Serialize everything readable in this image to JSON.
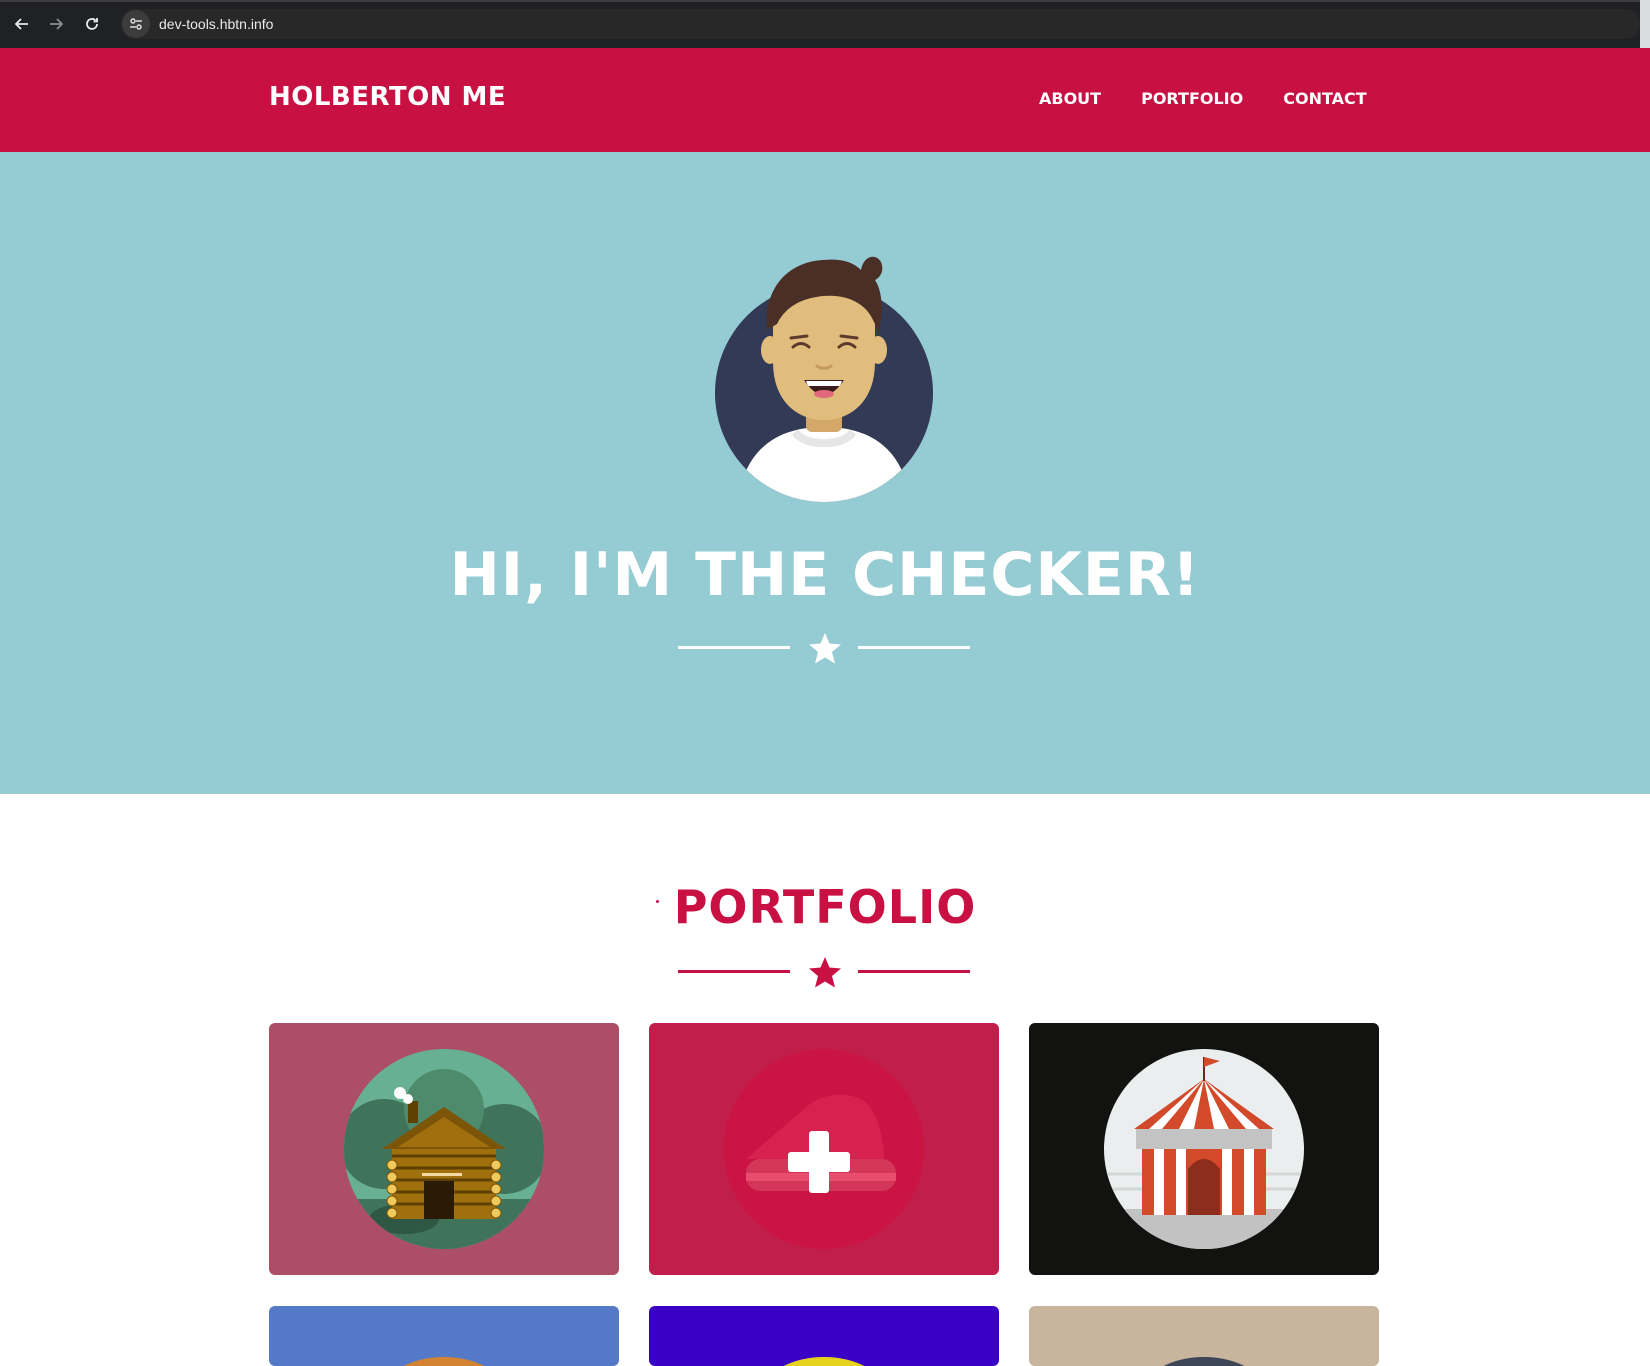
{
  "browser": {
    "url": "dev-tools.hbtn.info",
    "icons": [
      "back-arrow-icon",
      "forward-arrow-icon",
      "reload-icon",
      "site-info-icon"
    ]
  },
  "header": {
    "brand": "HOLBERTON ME",
    "nav": [
      "ABOUT",
      "PORTFOLIO",
      "CONTACT"
    ]
  },
  "hero": {
    "title": "HI, I'M THE CHECKER!"
  },
  "portfolio": {
    "title": "PORTFOLIO",
    "tiles": [
      {
        "icon": "cabin-icon",
        "bg": "#ad4e67"
      },
      {
        "icon": "cake-icon",
        "bg": "#c21e4b"
      },
      {
        "icon": "circus-tent-icon",
        "bg": "#121210"
      },
      {
        "icon": "partial-icon",
        "bg": "#5379c7"
      },
      {
        "icon": "partial-icon",
        "bg": "#3b00c6"
      },
      {
        "icon": "partial-icon",
        "bg": "#c9b49e"
      }
    ]
  },
  "colors": {
    "primary": "#c91043",
    "hero_bg": "#95cbd3",
    "white": "#ffffff"
  }
}
